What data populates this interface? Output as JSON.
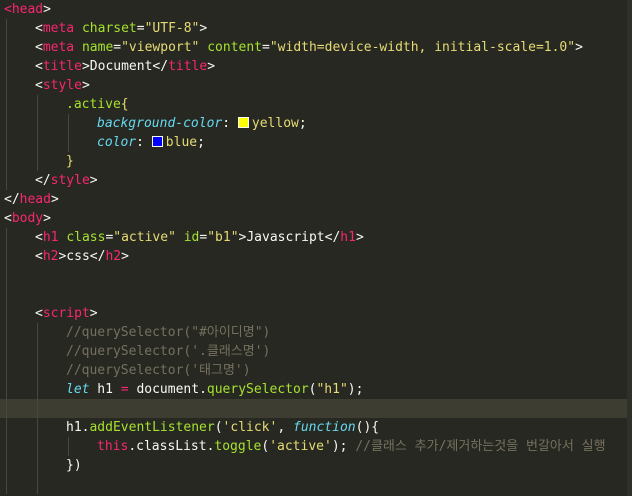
{
  "editor": {
    "theme_colors": {
      "background": "#272822",
      "current_line": "#3e3d32",
      "tag": "#f92672",
      "attribute": "#a6e22e",
      "string": "#e6db74",
      "comment": "#75715e",
      "keyword": "#66d9ef"
    },
    "highlighted_line": 21,
    "lines": [
      {
        "indent": 0,
        "tokens": [
          [
            "tag",
            "<head"
          ],
          [
            "plain",
            ">"
          ]
        ]
      },
      {
        "indent": 1,
        "tokens": [
          [
            "plain",
            "<"
          ],
          [
            "tag",
            "meta"
          ],
          [
            "plain",
            " "
          ],
          [
            "attr",
            "charset"
          ],
          [
            "plain",
            "="
          ],
          [
            "str",
            "\"UTF-8\""
          ],
          [
            "plain",
            ">"
          ]
        ]
      },
      {
        "indent": 1,
        "tokens": [
          [
            "plain",
            "<"
          ],
          [
            "tag",
            "meta"
          ],
          [
            "plain",
            " "
          ],
          [
            "attr",
            "name"
          ],
          [
            "plain",
            "="
          ],
          [
            "str",
            "\"viewport\""
          ],
          [
            "plain",
            " "
          ],
          [
            "attr",
            "content"
          ],
          [
            "plain",
            "="
          ],
          [
            "str",
            "\"width=device-width, initial-scale=1.0\""
          ],
          [
            "plain",
            ">"
          ]
        ]
      },
      {
        "indent": 1,
        "tokens": [
          [
            "plain",
            "<"
          ],
          [
            "tag",
            "title"
          ],
          [
            "plain",
            ">Document</"
          ],
          [
            "tag",
            "title"
          ],
          [
            "plain",
            ">"
          ]
        ]
      },
      {
        "indent": 1,
        "tokens": [
          [
            "plain",
            "<"
          ],
          [
            "tag",
            "style"
          ],
          [
            "plain",
            ">"
          ]
        ]
      },
      {
        "indent": 2,
        "tokens": [
          [
            "sel",
            ".active"
          ],
          [
            "str",
            "{"
          ]
        ]
      },
      {
        "indent": 3,
        "tokens": [
          [
            "prop",
            "background-color"
          ],
          [
            "plain",
            ": "
          ],
          [
            "swatch",
            "#ffff00"
          ],
          [
            "str",
            "yellow"
          ],
          [
            "plain",
            ";"
          ]
        ]
      },
      {
        "indent": 3,
        "tokens": [
          [
            "prop",
            "color"
          ],
          [
            "plain",
            ": "
          ],
          [
            "swatch",
            "#0000ff"
          ],
          [
            "str",
            "blue"
          ],
          [
            "plain",
            ";"
          ]
        ]
      },
      {
        "indent": 2,
        "tokens": [
          [
            "str",
            "}"
          ]
        ]
      },
      {
        "indent": 1,
        "tokens": [
          [
            "plain",
            "</"
          ],
          [
            "tag",
            "style"
          ],
          [
            "plain",
            ">"
          ]
        ]
      },
      {
        "indent": 0,
        "tokens": [
          [
            "plain",
            "</"
          ],
          [
            "tag",
            "head"
          ],
          [
            "plain",
            ">"
          ]
        ]
      },
      {
        "indent": 0,
        "tokens": [
          [
            "plain",
            "<"
          ],
          [
            "tag",
            "body"
          ],
          [
            "plain",
            ">"
          ]
        ]
      },
      {
        "indent": 1,
        "tokens": [
          [
            "plain",
            "<"
          ],
          [
            "tag",
            "h1"
          ],
          [
            "plain",
            " "
          ],
          [
            "attr",
            "class"
          ],
          [
            "plain",
            "="
          ],
          [
            "str",
            "\"active\""
          ],
          [
            "plain",
            " "
          ],
          [
            "attr",
            "id"
          ],
          [
            "plain",
            "="
          ],
          [
            "str",
            "\"b1\""
          ],
          [
            "plain",
            ">Javascript</"
          ],
          [
            "tag",
            "h1"
          ],
          [
            "plain",
            ">"
          ]
        ]
      },
      {
        "indent": 1,
        "tokens": [
          [
            "plain",
            "<"
          ],
          [
            "tag",
            "h2"
          ],
          [
            "plain",
            ">css</"
          ],
          [
            "tag",
            "h2"
          ],
          [
            "plain",
            ">"
          ]
        ]
      },
      {
        "indent": 1,
        "tokens": []
      },
      {
        "indent": 1,
        "tokens": []
      },
      {
        "indent": 1,
        "tokens": [
          [
            "plain",
            "<"
          ],
          [
            "tag",
            "script"
          ],
          [
            "plain",
            ">"
          ]
        ]
      },
      {
        "indent": 2,
        "tokens": [
          [
            "comment",
            "//querySelector(\"#아이디명\")"
          ]
        ]
      },
      {
        "indent": 2,
        "tokens": [
          [
            "comment",
            "//querySelector('.클래스명')"
          ]
        ]
      },
      {
        "indent": 2,
        "tokens": [
          [
            "comment",
            "//querySelector('태그명')"
          ]
        ]
      },
      {
        "indent": 2,
        "tokens": [
          [
            "kw",
            "let"
          ],
          [
            "plain",
            " h1 "
          ],
          [
            "kw2",
            "="
          ],
          [
            "plain",
            " document."
          ],
          [
            "func",
            "querySelector"
          ],
          [
            "plain",
            "("
          ],
          [
            "str",
            "\"h1\""
          ],
          [
            "plain",
            ");"
          ]
        ]
      },
      {
        "indent": 2,
        "tokens": []
      },
      {
        "indent": 2,
        "tokens": [
          [
            "plain",
            "h1."
          ],
          [
            "func",
            "addEventListener"
          ],
          [
            "plain",
            "("
          ],
          [
            "str",
            "'click'"
          ],
          [
            "plain",
            ", "
          ],
          [
            "kw",
            "function"
          ],
          [
            "plain",
            "(){"
          ]
        ]
      },
      {
        "indent": 3,
        "tokens": [
          [
            "kw2",
            "this"
          ],
          [
            "plain",
            ".classList."
          ],
          [
            "func",
            "toggle"
          ],
          [
            "plain",
            "("
          ],
          [
            "str",
            "'active'"
          ],
          [
            "plain",
            "); "
          ],
          [
            "comment",
            "//클래스 추가/제거하는것을 번갈아서 실행"
          ]
        ]
      },
      {
        "indent": 2,
        "tokens": [
          [
            "plain",
            "})"
          ]
        ]
      },
      {
        "indent": 2,
        "tokens": []
      }
    ]
  }
}
